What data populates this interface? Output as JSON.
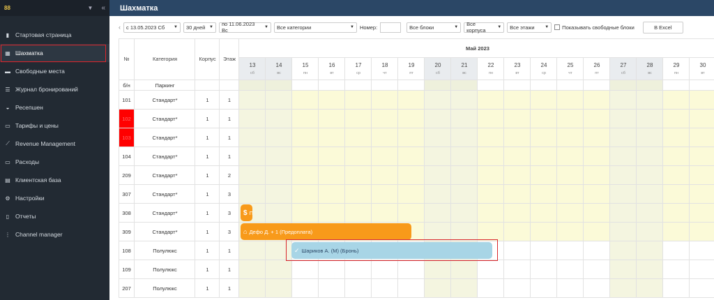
{
  "sidebar": {
    "logo": "88",
    "items": [
      {
        "label": "Стартовая страница",
        "icon": "bookmark-icon"
      },
      {
        "label": "Шахматка",
        "icon": "grid-icon",
        "active": true
      },
      {
        "label": "Свободные места",
        "icon": "bed-icon"
      },
      {
        "label": "Журнал бронирований",
        "icon": "list-icon"
      },
      {
        "label": "Ресепшен",
        "icon": "bell-icon"
      },
      {
        "label": "Тарифы и цены",
        "icon": "tag-icon"
      },
      {
        "label": "Revenue Management",
        "icon": "chart-line-icon"
      },
      {
        "label": "Расходы",
        "icon": "wallet-icon"
      },
      {
        "label": "Клиентская база",
        "icon": "contacts-icon"
      },
      {
        "label": "Настройки",
        "icon": "gear-icon"
      },
      {
        "label": "Отчеты",
        "icon": "document-icon"
      },
      {
        "label": "Channel manager",
        "icon": "share-icon"
      }
    ]
  },
  "header": {
    "title": "Шахматка"
  },
  "filters": {
    "date_from": "с 13.05.2023 Сб",
    "period": "30 дней",
    "date_to": "по 11.06.2023 Вс",
    "category": "Все категории",
    "number_label": "Номер:",
    "blocks": "Все блоки",
    "buildings": "Все корпуса",
    "floors": "Все этажи",
    "show_free_label": "Показывать свободные блоки",
    "excel_label": "В Excel"
  },
  "table": {
    "headers": {
      "num": "№",
      "category": "Категория",
      "building": "Корпус",
      "floor": "Этаж"
    },
    "month": "Май 2023",
    "days": [
      {
        "d": "13",
        "w": "сб",
        "weekend": true
      },
      {
        "d": "14",
        "w": "вс",
        "weekend": true
      },
      {
        "d": "15",
        "w": "пн"
      },
      {
        "d": "16",
        "w": "вт"
      },
      {
        "d": "17",
        "w": "ср"
      },
      {
        "d": "18",
        "w": "чт"
      },
      {
        "d": "19",
        "w": "пт"
      },
      {
        "d": "20",
        "w": "сб",
        "weekend": true
      },
      {
        "d": "21",
        "w": "вс",
        "weekend": true
      },
      {
        "d": "22",
        "w": "пн"
      },
      {
        "d": "23",
        "w": "вт"
      },
      {
        "d": "24",
        "w": "ср"
      },
      {
        "d": "25",
        "w": "чт"
      },
      {
        "d": "26",
        "w": "пт"
      },
      {
        "d": "27",
        "w": "сб",
        "weekend": true
      },
      {
        "d": "28",
        "w": "вс",
        "weekend": true
      },
      {
        "d": "29",
        "w": "пн"
      },
      {
        "d": "30",
        "w": "вт"
      }
    ],
    "rows": [
      {
        "num": "б/н",
        "category": "Паркинг",
        "building": "",
        "floor": "",
        "type": "parking"
      },
      {
        "num": "101",
        "category": "Стандарт*",
        "building": "1",
        "floor": "1"
      },
      {
        "num": "102",
        "category": "Стандарт*",
        "building": "1",
        "floor": "1",
        "flag": true
      },
      {
        "num": "103",
        "category": "Стандарт*",
        "building": "1",
        "floor": "1",
        "flag": true
      },
      {
        "num": "104",
        "category": "Стандарт*",
        "building": "1",
        "floor": "1"
      },
      {
        "num": "209",
        "category": "Стандарт*",
        "building": "1",
        "floor": "2"
      },
      {
        "num": "307",
        "category": "Стандарт*",
        "building": "1",
        "floor": "3"
      },
      {
        "num": "308",
        "category": "Стандарт*",
        "building": "1",
        "floor": "3"
      },
      {
        "num": "309",
        "category": "Стандарт*",
        "building": "1",
        "floor": "3"
      },
      {
        "num": "108",
        "category": "Полулюкс",
        "building": "1",
        "floor": "1",
        "type": "white"
      },
      {
        "num": "109",
        "category": "Полулюкс",
        "building": "1",
        "floor": "1",
        "type": "white"
      },
      {
        "num": "207",
        "category": "Полулюкс",
        "building": "1",
        "floor": "1",
        "type": "white"
      }
    ],
    "bookings": [
      {
        "row": 7,
        "start": 0,
        "span": 0.5,
        "label": "П",
        "style": "orange",
        "icon": "dollar-icon"
      },
      {
        "row": 8,
        "start": 0,
        "span": 6.5,
        "label": "Дефо Д. + 1 (Предоплата)",
        "style": "orange",
        "icon": "home-icon"
      },
      {
        "row": 9,
        "start": 1.5,
        "span": 8,
        "label": "Шариков А. (М) (Бронь)",
        "style": "blue",
        "icon": "check-icon"
      }
    ]
  },
  "colors": {
    "flag": "#ff0000",
    "weekend": "#f4f5e0",
    "workday": "#fbfad8",
    "header": "#2b4766"
  }
}
